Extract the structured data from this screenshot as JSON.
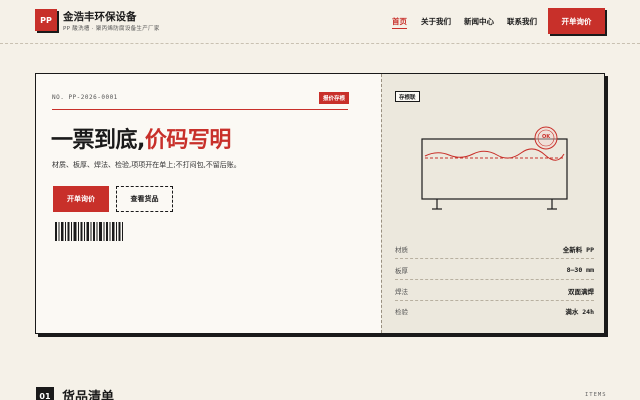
{
  "header": {
    "logo": "PP",
    "brand_name": "金浩丰环保设备",
    "brand_sub": "PP 酸洗槽 · 聚丙烯防腐设备生产厂家",
    "nav": [
      "首页",
      "关于我们",
      "新闻中心",
      "联系我们"
    ],
    "cta": "开单询价"
  },
  "ticket": {
    "number": "NO. PP-2026-0001",
    "badge": "报价存根",
    "headline_black": "一票到底,",
    "headline_red": "价码写明",
    "description": "材质、板厚、焊法、检验,项项开在单上;不打闷包,不留后账。",
    "primary_button": "开单询价",
    "secondary_button": "查看货品"
  },
  "stub": {
    "tag": "存根联",
    "stamp": "OK",
    "specs": [
      {
        "label": "材质",
        "value": "全新料 PP"
      },
      {
        "label": "板厚",
        "value": "8–30 mm"
      },
      {
        "label": "焊法",
        "value": "双面满焊"
      },
      {
        "label": "检验",
        "value": "满水 24h"
      }
    ]
  },
  "section": {
    "number": "01",
    "title": "货品清单",
    "en": "ITEMS"
  },
  "colors": {
    "accent": "#c8302a",
    "background": "#f5f1e8",
    "ink": "#1a1a1a"
  }
}
